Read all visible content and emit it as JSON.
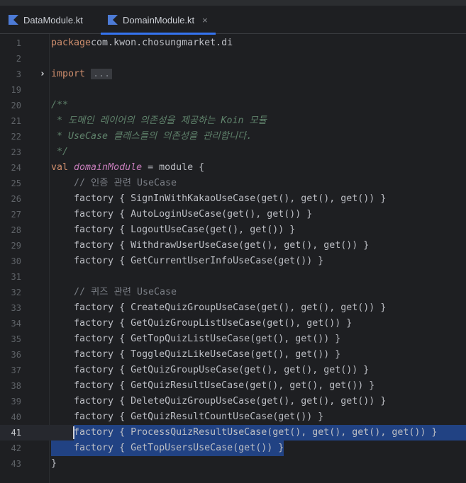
{
  "tabs": [
    {
      "label": "DataModule.kt",
      "active": false,
      "icon": "kotlin-file-icon"
    },
    {
      "label": "DomainModule.kt",
      "active": true,
      "icon": "kotlin-file-icon",
      "close": "×"
    }
  ],
  "editor": {
    "current_line": 41,
    "selection_lines": [
      41,
      42
    ],
    "fold_marker": "...",
    "fold_chevron": "›",
    "lines": [
      {
        "n": "1",
        "tokens": [
          [
            "kw",
            "package"
          ],
          [
            "",
            "com.kwon.chosungmarket.di"
          ]
        ]
      },
      {
        "n": "2",
        "tokens": []
      },
      {
        "n": "3",
        "tokens": [
          [
            "kw",
            "import"
          ],
          [
            "",
            ""
          ]
        ],
        "fold": true
      },
      {
        "n": "19",
        "tokens": []
      },
      {
        "n": "20",
        "tokens": [
          [
            "doc",
            "/**"
          ]
        ]
      },
      {
        "n": "21",
        "tokens": [
          [
            "doc",
            " * 도메인 레이어의 의존성을 제공하는 Koin 모듈"
          ]
        ]
      },
      {
        "n": "22",
        "tokens": [
          [
            "doc",
            " * UseCase 클래스들의 의존성을 관리합니다."
          ]
        ]
      },
      {
        "n": "23",
        "tokens": [
          [
            "doc",
            " */"
          ]
        ]
      },
      {
        "n": "24",
        "tokens": [
          [
            "kw",
            "val "
          ],
          [
            "prop",
            "domainModule"
          ],
          [
            "",
            " = module {"
          ]
        ]
      },
      {
        "n": "25",
        "tokens": [
          [
            "cmt",
            "    // 인증 관련 UseCase"
          ]
        ]
      },
      {
        "n": "26",
        "tokens": [
          [
            "",
            "    factory { SignInWithKakaoUseCase(get(), get(), get()) }"
          ]
        ]
      },
      {
        "n": "27",
        "tokens": [
          [
            "",
            "    factory { AutoLoginUseCase(get(), get()) }"
          ]
        ]
      },
      {
        "n": "28",
        "tokens": [
          [
            "",
            "    factory { LogoutUseCase(get(), get()) }"
          ]
        ]
      },
      {
        "n": "29",
        "tokens": [
          [
            "",
            "    factory { WithdrawUserUseCase(get(), get(), get()) }"
          ]
        ]
      },
      {
        "n": "30",
        "tokens": [
          [
            "",
            "    factory { GetCurrentUserInfoUseCase(get()) }"
          ]
        ]
      },
      {
        "n": "31",
        "tokens": []
      },
      {
        "n": "32",
        "tokens": [
          [
            "cmt",
            "    // 퀴즈 관련 UseCase"
          ]
        ]
      },
      {
        "n": "33",
        "tokens": [
          [
            "",
            "    factory { CreateQuizGroupUseCase(get(), get(), get()) }"
          ]
        ]
      },
      {
        "n": "34",
        "tokens": [
          [
            "",
            "    factory { GetQuizGroupListUseCase(get(), get()) }"
          ]
        ]
      },
      {
        "n": "35",
        "tokens": [
          [
            "",
            "    factory { GetTopQuizListUseCase(get(), get()) }"
          ]
        ]
      },
      {
        "n": "36",
        "tokens": [
          [
            "",
            "    factory { ToggleQuizLikeUseCase(get(), get()) }"
          ]
        ]
      },
      {
        "n": "37",
        "tokens": [
          [
            "",
            "    factory { GetQuizGroupUseCase(get(), get(), get()) }"
          ]
        ]
      },
      {
        "n": "38",
        "tokens": [
          [
            "",
            "    factory { GetQuizResultUseCase(get(), get(), get()) }"
          ]
        ]
      },
      {
        "n": "39",
        "tokens": [
          [
            "",
            "    factory { DeleteQuizGroupUseCase(get(), get(), get()) }"
          ]
        ]
      },
      {
        "n": "40",
        "tokens": [
          [
            "",
            "    factory { GetQuizResultCountUseCase(get()) }"
          ]
        ]
      },
      {
        "n": "41",
        "tokens": [
          [
            "",
            "    factory { ProcessQuizResultUseCase(get(), get(), get(), get()) }"
          ]
        ]
      },
      {
        "n": "42",
        "tokens": [
          [
            "",
            "    factory { GetTopUsersUseCase(get()) }"
          ]
        ]
      },
      {
        "n": "43",
        "tokens": [
          [
            "",
            "}"
          ]
        ]
      }
    ]
  },
  "colors": {
    "background": "#1e1f22",
    "keyword": "#cf8e6d",
    "comment": "#7a7e85",
    "doc_comment": "#5f826b",
    "property": "#c77dbb",
    "selection": "#214283",
    "tab_accent": "#3574f0"
  }
}
